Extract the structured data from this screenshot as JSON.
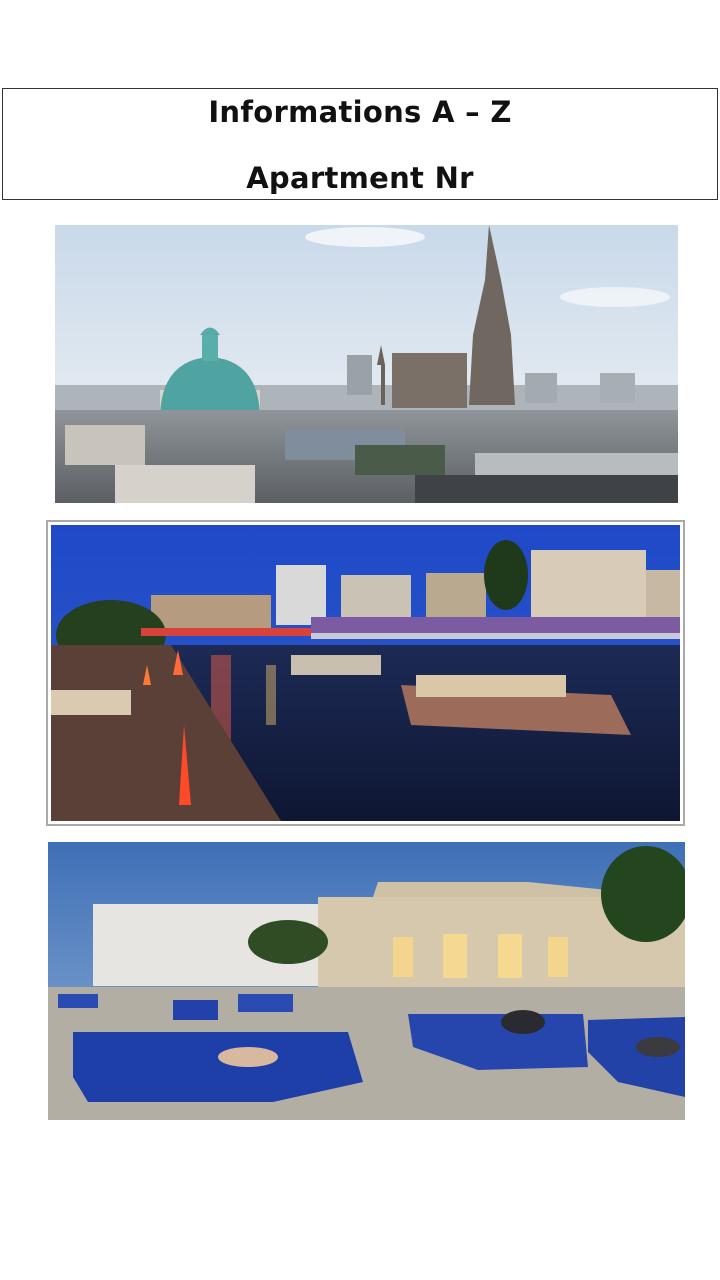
{
  "header": {
    "title": "Informations A – Z",
    "subtitle": "Apartment Nr"
  },
  "colors": {
    "border": "#333333",
    "frame": "#a9a9a9",
    "dome": "#4fa3a0",
    "night_sky": "#1f49c8",
    "dusk_sky": "#4f7fc0",
    "lounger_blue": "#1f3fa8"
  }
}
